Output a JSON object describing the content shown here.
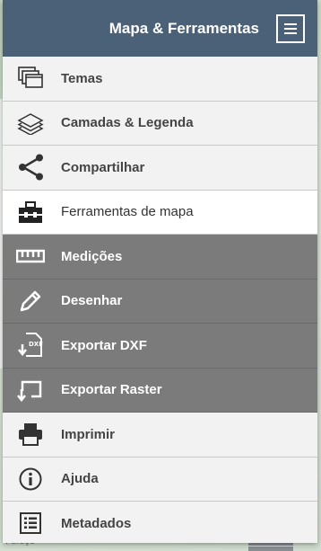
{
  "header": {
    "title": "Mapa & Ferramentas",
    "menu_icon": "hamburger-icon"
  },
  "menu": {
    "items": [
      {
        "label": "Temas",
        "icon": "layers-stack-icon"
      },
      {
        "label": "Camadas & Legenda",
        "icon": "layers-icon"
      },
      {
        "label": "Compartilhar",
        "icon": "share-icon"
      },
      {
        "label": "Ferramentas de mapa",
        "icon": "toolbox-icon"
      },
      {
        "label": "Medições",
        "icon": "ruler-icon"
      },
      {
        "label": "Desenhar",
        "icon": "pencil-icon"
      },
      {
        "label": "Exportar DXF",
        "icon": "export-dxf-icon"
      },
      {
        "label": "Exportar Raster",
        "icon": "export-raster-icon"
      },
      {
        "label": "Imprimir",
        "icon": "printer-icon"
      },
      {
        "label": "Ajuda",
        "icon": "info-icon"
      },
      {
        "label": "Metadados",
        "icon": "list-icon"
      }
    ]
  },
  "map": {
    "bottom_label": "Puleçu"
  },
  "colors": {
    "header": "#4b6178",
    "submenu": "#7b7b7b",
    "active": "#ffffff",
    "panel": "#f2f2f2"
  }
}
